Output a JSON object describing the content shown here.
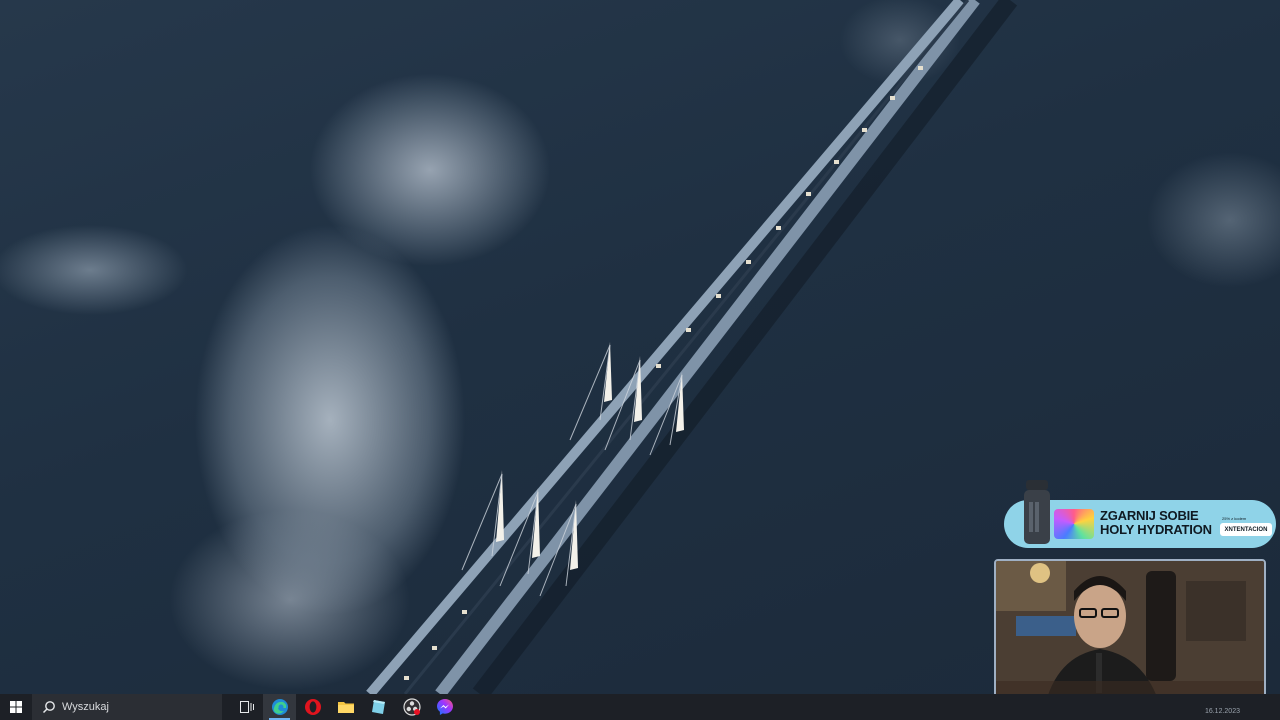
{
  "desktop": {
    "wallpaper": "aerial bridge over sea with clouds"
  },
  "promo_banner": {
    "title": "ZGARNIJ SOBIE\nHOLY HYDRATION",
    "code_label": "25% z kodem",
    "code": "XNTENTACION",
    "colors": {
      "background": "#8fd3e8",
      "text": "#0f1a22"
    }
  },
  "webcam": {
    "description_icon": "webcam-feed"
  },
  "taskbar": {
    "search_placeholder": "Wyszukaj",
    "apps": [
      {
        "name": "task-view",
        "icon": "task-view-icon"
      },
      {
        "name": "edge",
        "icon": "edge-icon"
      },
      {
        "name": "opera",
        "icon": "opera-icon"
      },
      {
        "name": "file-explorer",
        "icon": "folder-icon"
      },
      {
        "name": "notepad",
        "icon": "notepad-icon"
      },
      {
        "name": "obs",
        "icon": "obs-icon"
      },
      {
        "name": "messenger",
        "icon": "messenger-icon"
      }
    ],
    "clock": "16.12.2023",
    "colors": {
      "background": "#1d2026",
      "accent": "#6fb3f2"
    }
  }
}
